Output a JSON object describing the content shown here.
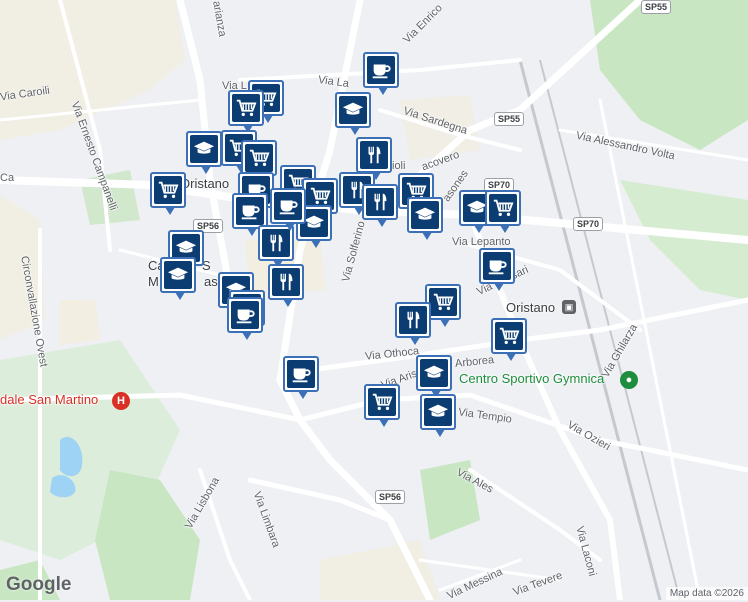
{
  "map": {
    "colors": {
      "land": "#eef0f3",
      "road": "#ffffff",
      "park": "#c9e6c3",
      "water": "#9fd3f5",
      "built": "#f4ecd8",
      "pin_border": "#3b6fb6",
      "pin_fill": "#0b3d73"
    },
    "place_labels": {
      "oristano": "Oristano",
      "cattedrale_1": "Catted",
      "cattedrale_2": "S",
      "cattedrale_3": "M",
      "cattedrale_4": "assu",
      "station": "Oristano",
      "centro_sportivo": "Centro Sportivo Gymnica",
      "ospedale": "dale San Martino"
    },
    "street_labels": {
      "via_caroili": "Via Caroili",
      "via_ernesto_campanelli": "Via Ernesto Campanelli",
      "circonvallazione_ovest": "Circonvallazione Ovest",
      "via_solferino": "Via Solferino",
      "via_othoca": "Via Othoca",
      "via_arborea": "Arborea",
      "via_aristana": "Via Aristana",
      "via_tempio": "Via Tempio",
      "via_sassari": "Via Sassari",
      "via_lepanto": "Via Lepanto",
      "via_sardegna": "Via Sardegna",
      "via_alessandro_volta": "Via Alessandro Volta",
      "via_ghilarza": "Via Ghilarza",
      "via_ozieri": "Via Ozieri",
      "via_ales": "Via Ales",
      "via_laconi": "Via Laconi",
      "via_messina": "Via Messina",
      "via_tevere": "Via Tevere",
      "via_lisbona": "Via Lisbona",
      "via_limbara": "Via Limbara",
      "via_enrico": "Via Enrico",
      "via_la": "Via La",
      "via_lacovero": "acovero",
      "via_masones": "asones",
      "via_vittorio": "ioli",
      "carianza": "arianza",
      "via_top": "Via L",
      "via_ca": "Ca"
    },
    "road_shields": [
      "SP55",
      "SP55",
      "SP70",
      "SP70",
      "SP56",
      "SP56"
    ],
    "markers": [
      {
        "type": "cafe"
      },
      {
        "type": "shopping"
      },
      {
        "type": "shopping"
      },
      {
        "type": "education"
      },
      {
        "type": "education"
      },
      {
        "type": "shopping"
      },
      {
        "type": "shopping"
      },
      {
        "type": "restaurant"
      },
      {
        "type": "shopping"
      },
      {
        "type": "cafe"
      },
      {
        "type": "shopping"
      },
      {
        "type": "cafe"
      },
      {
        "type": "shopping"
      },
      {
        "type": "restaurant"
      },
      {
        "type": "restaurant"
      },
      {
        "type": "shopping"
      },
      {
        "type": "education"
      },
      {
        "type": "cafe"
      },
      {
        "type": "education"
      },
      {
        "type": "restaurant"
      },
      {
        "type": "education"
      },
      {
        "type": "education"
      },
      {
        "type": "education"
      },
      {
        "type": "shopping"
      },
      {
        "type": "cafe"
      },
      {
        "type": "education"
      },
      {
        "type": "restaurant"
      },
      {
        "type": "cafe"
      },
      {
        "type": "cafe"
      },
      {
        "type": "shopping"
      },
      {
        "type": "restaurant"
      },
      {
        "type": "shopping"
      },
      {
        "type": "education"
      },
      {
        "type": "cafe"
      },
      {
        "type": "shopping"
      },
      {
        "type": "education"
      }
    ],
    "attribution": "Map data ©2026",
    "logo": "Google"
  }
}
